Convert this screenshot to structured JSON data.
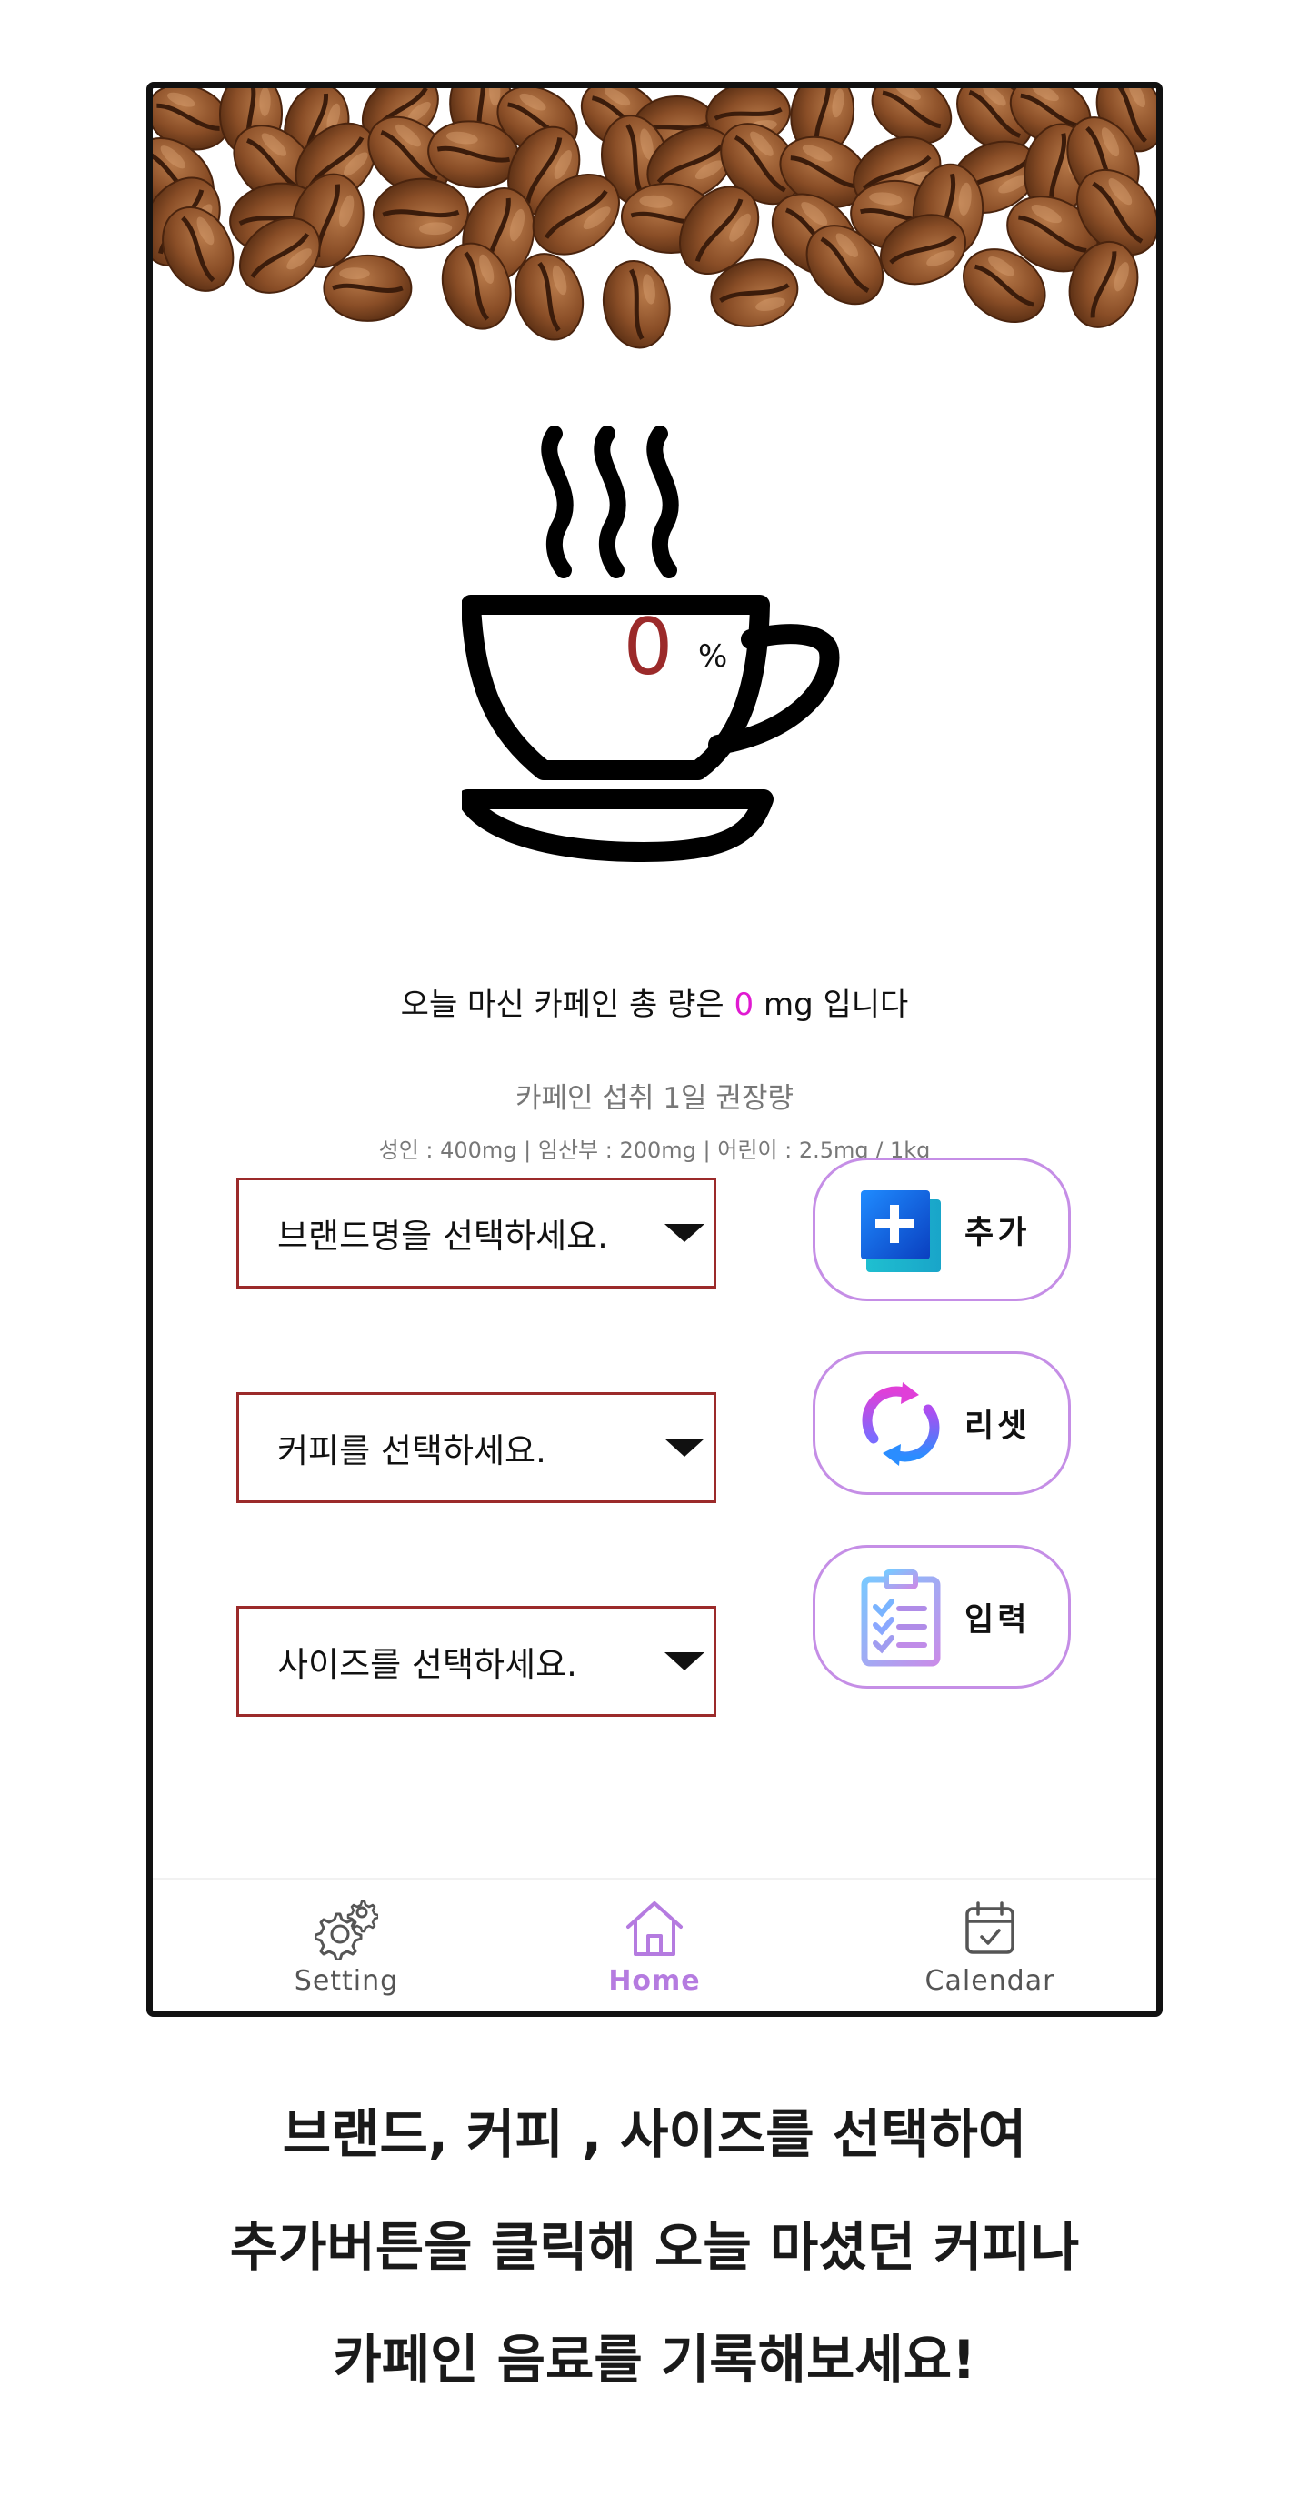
{
  "gauge": {
    "percent_value": "0",
    "percent_sign": "%"
  },
  "summary": {
    "prefix": "오늘 마신 카페인 총 량은 ",
    "amount": "0",
    "suffix": " mg 입니다"
  },
  "recommendation": {
    "title": "카페인 섭취 1일 권장량",
    "detail": "성인 : 400mg | 임산부 : 200mg | 어린이 : 2.5mg / 1kg"
  },
  "selects": {
    "brand": "브랜드명을 선택하세요.",
    "coffee": "커피를 선택하세요.",
    "size": "사이즈를 선택하세요."
  },
  "buttons": {
    "add": "추가",
    "reset": "리셋",
    "input": "입력"
  },
  "nav": {
    "setting": "Setting",
    "home": "Home",
    "calendar": "Calendar"
  },
  "caption": {
    "line1": "브랜드, 커피 , 사이즈를 선택하여",
    "line2": "추가버튼을 클릭해 오늘 마셨던 커피나",
    "line3": "카페인 음료를 기록해보세요!"
  },
  "colors": {
    "percent": "#9b2a2a",
    "amount": "#e01ad1",
    "select_border": "#9b2a2a",
    "button_border": "#c58ee6",
    "nav_active": "#b57be0",
    "nav_inactive": "#555555"
  },
  "icons": [
    "coffee-beans-banner",
    "coffee-cup-icon",
    "add-icon",
    "reset-icon",
    "clipboard-icon",
    "gear-icon",
    "home-icon",
    "calendar-icon"
  ]
}
